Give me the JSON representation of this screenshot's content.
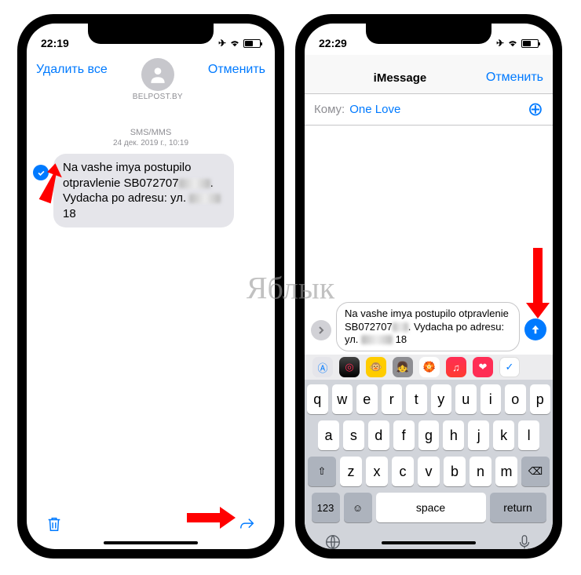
{
  "watermark": "Яблык",
  "left": {
    "time": "22:19",
    "nav": {
      "delete_all": "Удалить все",
      "cancel": "Отменить",
      "contact": "BELPOST.BY"
    },
    "thread": {
      "channel": "SMS/MMS",
      "date": "24 дек. 2019 г., 10:19",
      "msg_part1": "Na vashe imya postupilo otpravlenie SB072707",
      "msg_part2": ". Vydacha po adresu: ул.",
      "msg_part3": " 18"
    }
  },
  "right": {
    "time": "22:29",
    "nav": {
      "title": "iMessage",
      "cancel": "Отменить"
    },
    "to": {
      "label": "Кому:",
      "value": "One Love"
    },
    "compose": {
      "msg_part1": "Na vashe imya postupilo otpravlenie SB072707",
      "msg_part2": ". Vydacha po adresu: ул.",
      "msg_part3": " 18"
    },
    "keyboard": {
      "row1": [
        "q",
        "w",
        "e",
        "r",
        "t",
        "y",
        "u",
        "i",
        "o",
        "p"
      ],
      "row2": [
        "a",
        "s",
        "d",
        "f",
        "g",
        "h",
        "j",
        "k",
        "l"
      ],
      "row3": [
        "z",
        "x",
        "c",
        "v",
        "b",
        "n",
        "m"
      ],
      "fn123": "123",
      "space": "space",
      "return": "return"
    }
  }
}
